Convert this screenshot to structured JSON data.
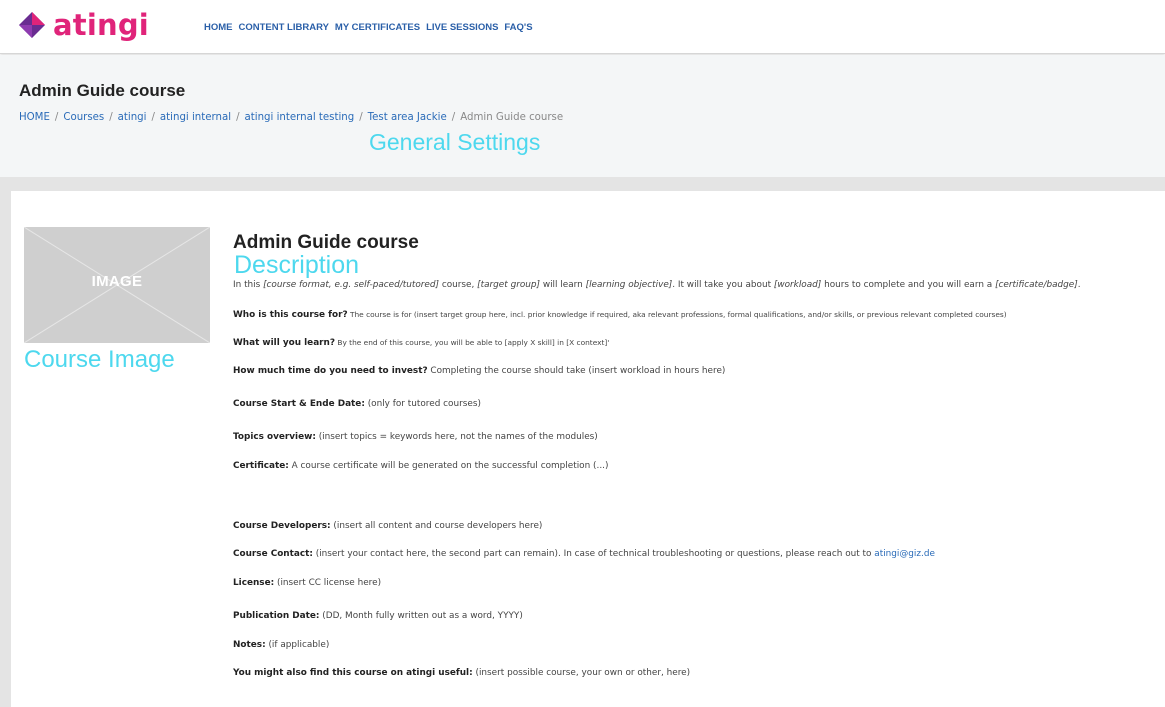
{
  "brand": {
    "name": "atingi",
    "logo_icon": "diamond-logo-icon",
    "color": "#e0247a",
    "accent_purple": "#6a2c91"
  },
  "nav": {
    "items": [
      {
        "label": "HOME"
      },
      {
        "label": "CONTENT LIBRARY"
      },
      {
        "label": "MY CERTIFICATES"
      },
      {
        "label": "LIVE SESSIONS"
      },
      {
        "label": "FAQ'S"
      }
    ]
  },
  "header": {
    "title": "Admin Guide course",
    "breadcrumb": [
      "HOME",
      "Courses",
      "atingi",
      "atingi internal",
      "atingi internal testing",
      "Test area Jackie"
    ],
    "breadcrumb_current": "Admin Guide course",
    "annotation": "General Settings"
  },
  "course": {
    "image_placeholder": "IMAGE",
    "image_annotation": "Course Image",
    "title": "Admin Guide course",
    "description_annotation": "Description",
    "intro": {
      "p1": "In this ",
      "format": "[course format, e.g. self-paced/tutored]",
      "p2": " course, ",
      "target": "[target group]",
      "p3": " will learn ",
      "objective": "[learning objective]",
      "p4": ". It will take you about ",
      "workload": "[workload]",
      "p5": " hours to complete and you will earn a ",
      "certificate": "[certificate/badge]",
      "p6": "."
    },
    "who": {
      "label": "Who is this course for?",
      "text": " The course is for (insert target group here, incl. prior knowledge if required, aka relevant professions, formal qualifications, and/or skills, or previous relevant completed courses)"
    },
    "what": {
      "label": "What will you learn?",
      "text": " By the end of this course, you will be able to [apply X skill] in  [X context]'"
    },
    "time": {
      "label": "How much time do you need to invest?",
      "text": " Completing the course should take (insert workload in hours here)"
    },
    "dates": {
      "label": "Course Start & Ende Date:",
      "text": " (only for tutored courses)"
    },
    "topics": {
      "label": "Topics overview:",
      "text": " (insert topics = keywords here, not the names of the modules)"
    },
    "certificate": {
      "label": "Certificate:",
      "text": " A course certificate will be generated on the successful completion (...)"
    },
    "developers": {
      "label": "Course Developers:",
      "text": " (insert all content and course developers here)"
    },
    "contact": {
      "label": "Course Contact:",
      "text": " (insert your contact here, the second part can remain). In case of technical troubleshooting or questions, please reach out to ",
      "email": "atingi@giz.de"
    },
    "license": {
      "label": "License:",
      "text": " (insert CC license here)"
    },
    "publication": {
      "label": "Publication Date:",
      "text": " (DD, Month fully written out as a word, YYYY)"
    },
    "notes": {
      "label": "Notes:",
      "text": " (if applicable)"
    },
    "also": {
      "label": "You might also find this course on atingi useful:",
      "text": " (insert possible course, your own or other, here)"
    }
  }
}
